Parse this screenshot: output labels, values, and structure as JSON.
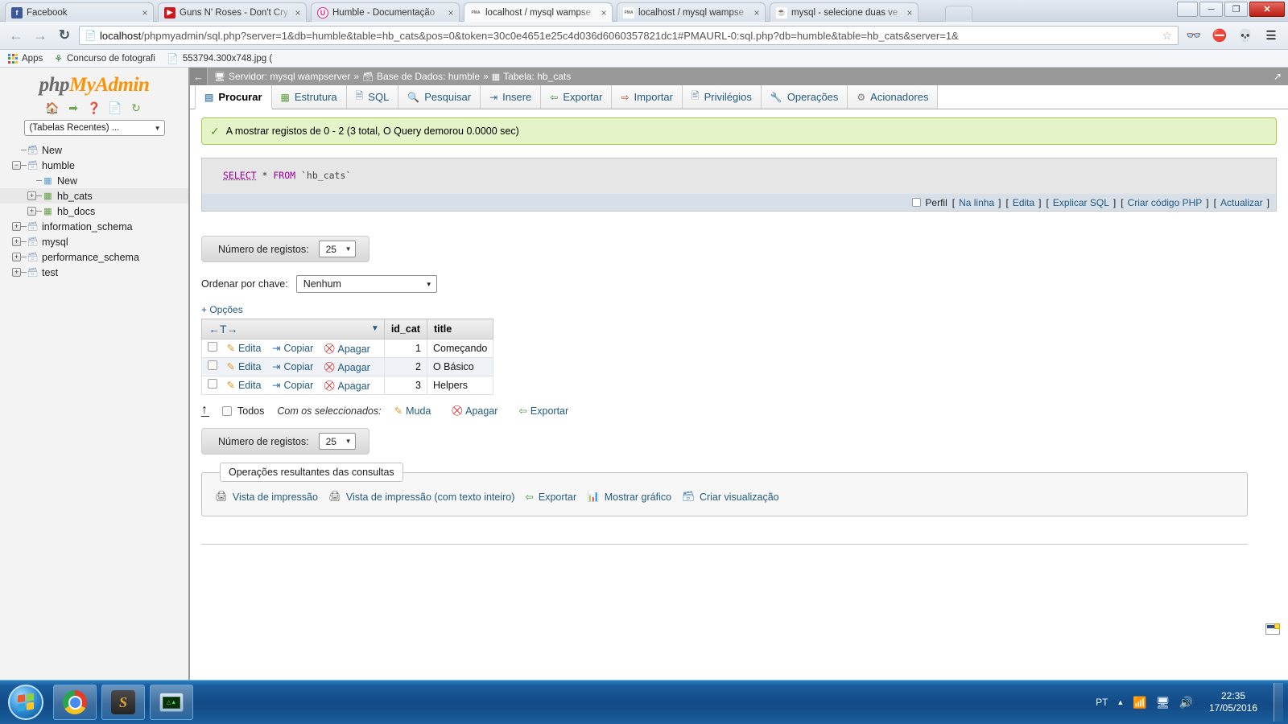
{
  "browser": {
    "tabs": [
      {
        "label": "Facebook",
        "favicon": "facebook-icon",
        "color": "#3b5998",
        "glyph": "f"
      },
      {
        "label": "Guns N' Roses - Don't Cry",
        "favicon": "youtube-icon",
        "color": "#cc181e",
        "glyph": "▶"
      },
      {
        "label": "Humble - Documentação",
        "favicon": "humble-icon",
        "color": "#e51f8f",
        "glyph": "U"
      },
      {
        "label": "localhost / mysql wampse",
        "favicon": "phpmyadmin-icon",
        "color": "#ffffff",
        "glyph": "PMA"
      },
      {
        "label": "localhost / mysql wampse",
        "favicon": "phpmyadmin-icon",
        "color": "#ffffff",
        "glyph": "PMA"
      },
      {
        "label": "mysql - selecione duas ve",
        "favicon": "java-icon",
        "color": "#ffffff",
        "glyph": "☕"
      }
    ],
    "active_tab_index": 3,
    "close_label": "×",
    "nav": {
      "back_icon": "back-arrow-icon",
      "forward_icon": "forward-arrow-icon",
      "reload_icon": "reload-icon",
      "page_icon": "page-icon",
      "star_icon": "bookmark-star-icon",
      "url_host": "localhost",
      "url_rest": "/phpmyadmin/sql.php?server=1&db=humble&table=hb_cats&pos=0&token=30c0e4651e25c4d036d6060357821dc1#PMAURL-0:sql.php?db=humble&table=hb_cats&server=1&",
      "extensions": [
        "adblock-eyes-icon",
        "adblock-stop-icon",
        "troll-face-icon"
      ],
      "menu_icon": "hamburger-menu-icon"
    },
    "bookmarks": [
      {
        "label": "Apps",
        "icon": "apps-grid-icon"
      },
      {
        "label": "Concurso de fotografi",
        "icon": "bookmark-tree-icon"
      },
      {
        "label": "553794.300x748.jpg (",
        "icon": "file-icon"
      }
    ],
    "window_controls": {
      "user_icon": "user-icon",
      "minimize": "─",
      "maximize": "❐",
      "close": "✕"
    }
  },
  "sidebar": {
    "logo_part1": "php",
    "logo_part2": "MyAdmin",
    "quick_icons": [
      "home-icon",
      "logout-icon",
      "help-icon",
      "docs-icon",
      "reload-icon"
    ],
    "recent_select": "(Tabelas Recentes) ...",
    "tree": [
      {
        "label": "New",
        "icon": "new-database-icon",
        "depth": 0,
        "toggle": "none",
        "selected": false
      },
      {
        "label": "humble",
        "icon": "database-icon",
        "depth": 0,
        "toggle": "minus",
        "selected": false
      },
      {
        "label": "New",
        "icon": "new-table-icon",
        "depth": 1,
        "toggle": "none",
        "selected": false
      },
      {
        "label": "hb_cats",
        "icon": "table-icon",
        "depth": 1,
        "toggle": "plus",
        "selected": true
      },
      {
        "label": "hb_docs",
        "icon": "table-icon",
        "depth": 1,
        "toggle": "plus",
        "selected": false
      },
      {
        "label": "information_schema",
        "icon": "database-icon",
        "depth": 0,
        "toggle": "plus",
        "selected": false
      },
      {
        "label": "mysql",
        "icon": "database-icon",
        "depth": 0,
        "toggle": "plus",
        "selected": false
      },
      {
        "label": "performance_schema",
        "icon": "database-icon",
        "depth": 0,
        "toggle": "plus",
        "selected": false
      },
      {
        "label": "test",
        "icon": "database-icon",
        "depth": 0,
        "toggle": "plus",
        "selected": false
      }
    ]
  },
  "main": {
    "breadcrumb": {
      "back_icon": "back-arrow-icon",
      "server_icon": "server-icon",
      "server": "Servidor: mysql wampserver",
      "sep1": "»",
      "db_icon": "database-icon",
      "database": "Base de Dados: humble",
      "sep2": "»",
      "table_icon": "table-icon",
      "table": "Tabela: hb_cats",
      "collapse_icon": "collapse-icon"
    },
    "tabs": [
      {
        "label": "Procurar",
        "icon": "browse-icon",
        "active": true
      },
      {
        "label": "Estrutura",
        "icon": "structure-icon",
        "active": false
      },
      {
        "label": "SQL",
        "icon": "sql-icon",
        "active": false
      },
      {
        "label": "Pesquisar",
        "icon": "search-icon",
        "active": false
      },
      {
        "label": "Insere",
        "icon": "insert-icon",
        "active": false
      },
      {
        "label": "Exportar",
        "icon": "export-icon",
        "active": false
      },
      {
        "label": "Importar",
        "icon": "import-icon",
        "active": false
      },
      {
        "label": "Privilégios",
        "icon": "privileges-icon",
        "active": false
      },
      {
        "label": "Operações",
        "icon": "operations-icon",
        "active": false
      },
      {
        "label": "Acionadores",
        "icon": "triggers-icon",
        "active": false
      }
    ],
    "notice": {
      "icon": "success-check-icon",
      "text": "A mostrar registos de 0 - 2 (3 total, O Query demorou 0.0000 sec)"
    },
    "sql": {
      "keyword": "SELECT",
      "star": "*",
      "from": "FROM",
      "table": "`hb_cats`"
    },
    "sql_footer": {
      "profile_label": "Perfil",
      "links": [
        "Na linha",
        "Edita",
        "Explicar SQL",
        "Criar código PHP",
        "Actualizar"
      ],
      "open_bracket": "[",
      "close_bracket": "]"
    },
    "rows_control_top": {
      "label": "Número de registos:",
      "value": "25"
    },
    "order_by": {
      "label": "Ordenar por chave:",
      "value": "Nenhum"
    },
    "options_link": "+ Opções",
    "table": {
      "header_sort": "←T→",
      "header_sort_arrow": "▼",
      "columns": [
        "id_cat",
        "title"
      ],
      "row_actions": [
        {
          "label": "Edita",
          "icon": "pencil-icon"
        },
        {
          "label": "Copiar",
          "icon": "copy-icon"
        },
        {
          "label": "Apagar",
          "icon": "delete-icon"
        }
      ],
      "rows": [
        {
          "id_cat": "1",
          "title": "Começando"
        },
        {
          "id_cat": "2",
          "title": "O Básico"
        },
        {
          "id_cat": "3",
          "title": "Helpers"
        }
      ]
    },
    "with_selected": {
      "up_arrow_icon": "select-all-arrow-icon",
      "check_all": "Todos",
      "label": "Com os seleccionados:",
      "actions": [
        {
          "label": "Muda",
          "icon": "pencil-icon"
        },
        {
          "label": "Apagar",
          "icon": "delete-icon"
        },
        {
          "label": "Exportar",
          "icon": "export-icon"
        }
      ]
    },
    "rows_control_bottom": {
      "label": "Número de registos:",
      "value": "25"
    },
    "query_results": {
      "legend": "Operações resultantes das consultas",
      "operations": [
        {
          "label": "Vista de impressão",
          "icon": "print-icon"
        },
        {
          "label": "Vista de impressão (com texto inteiro)",
          "icon": "print-icon"
        },
        {
          "label": "Exportar",
          "icon": "export-icon"
        },
        {
          "label": "Mostrar gráfico",
          "icon": "chart-icon"
        },
        {
          "label": "Criar visualização",
          "icon": "view-icon"
        }
      ]
    }
  },
  "taskbar": {
    "start_icon": "windows-start-icon",
    "buttons": [
      {
        "name": "chrome-taskbar-button",
        "icon": "chrome-icon"
      },
      {
        "name": "sublime-taskbar-button",
        "icon": "sublime-icon"
      },
      {
        "name": "wampserver-taskbar-button",
        "icon": "wampserver-icon"
      }
    ],
    "tray": {
      "language": "PT",
      "show_hidden_icon": "chevron-up-icon",
      "icons": [
        "network-error-icon",
        "monitor-icon",
        "volume-icon"
      ],
      "time": "22:35",
      "date": "17/05/2016"
    }
  },
  "colors": {
    "accent": "#235a81",
    "pma_orange": "#f89406",
    "notice_bg": "#e5f4c8",
    "taskbar": "#124a85"
  }
}
